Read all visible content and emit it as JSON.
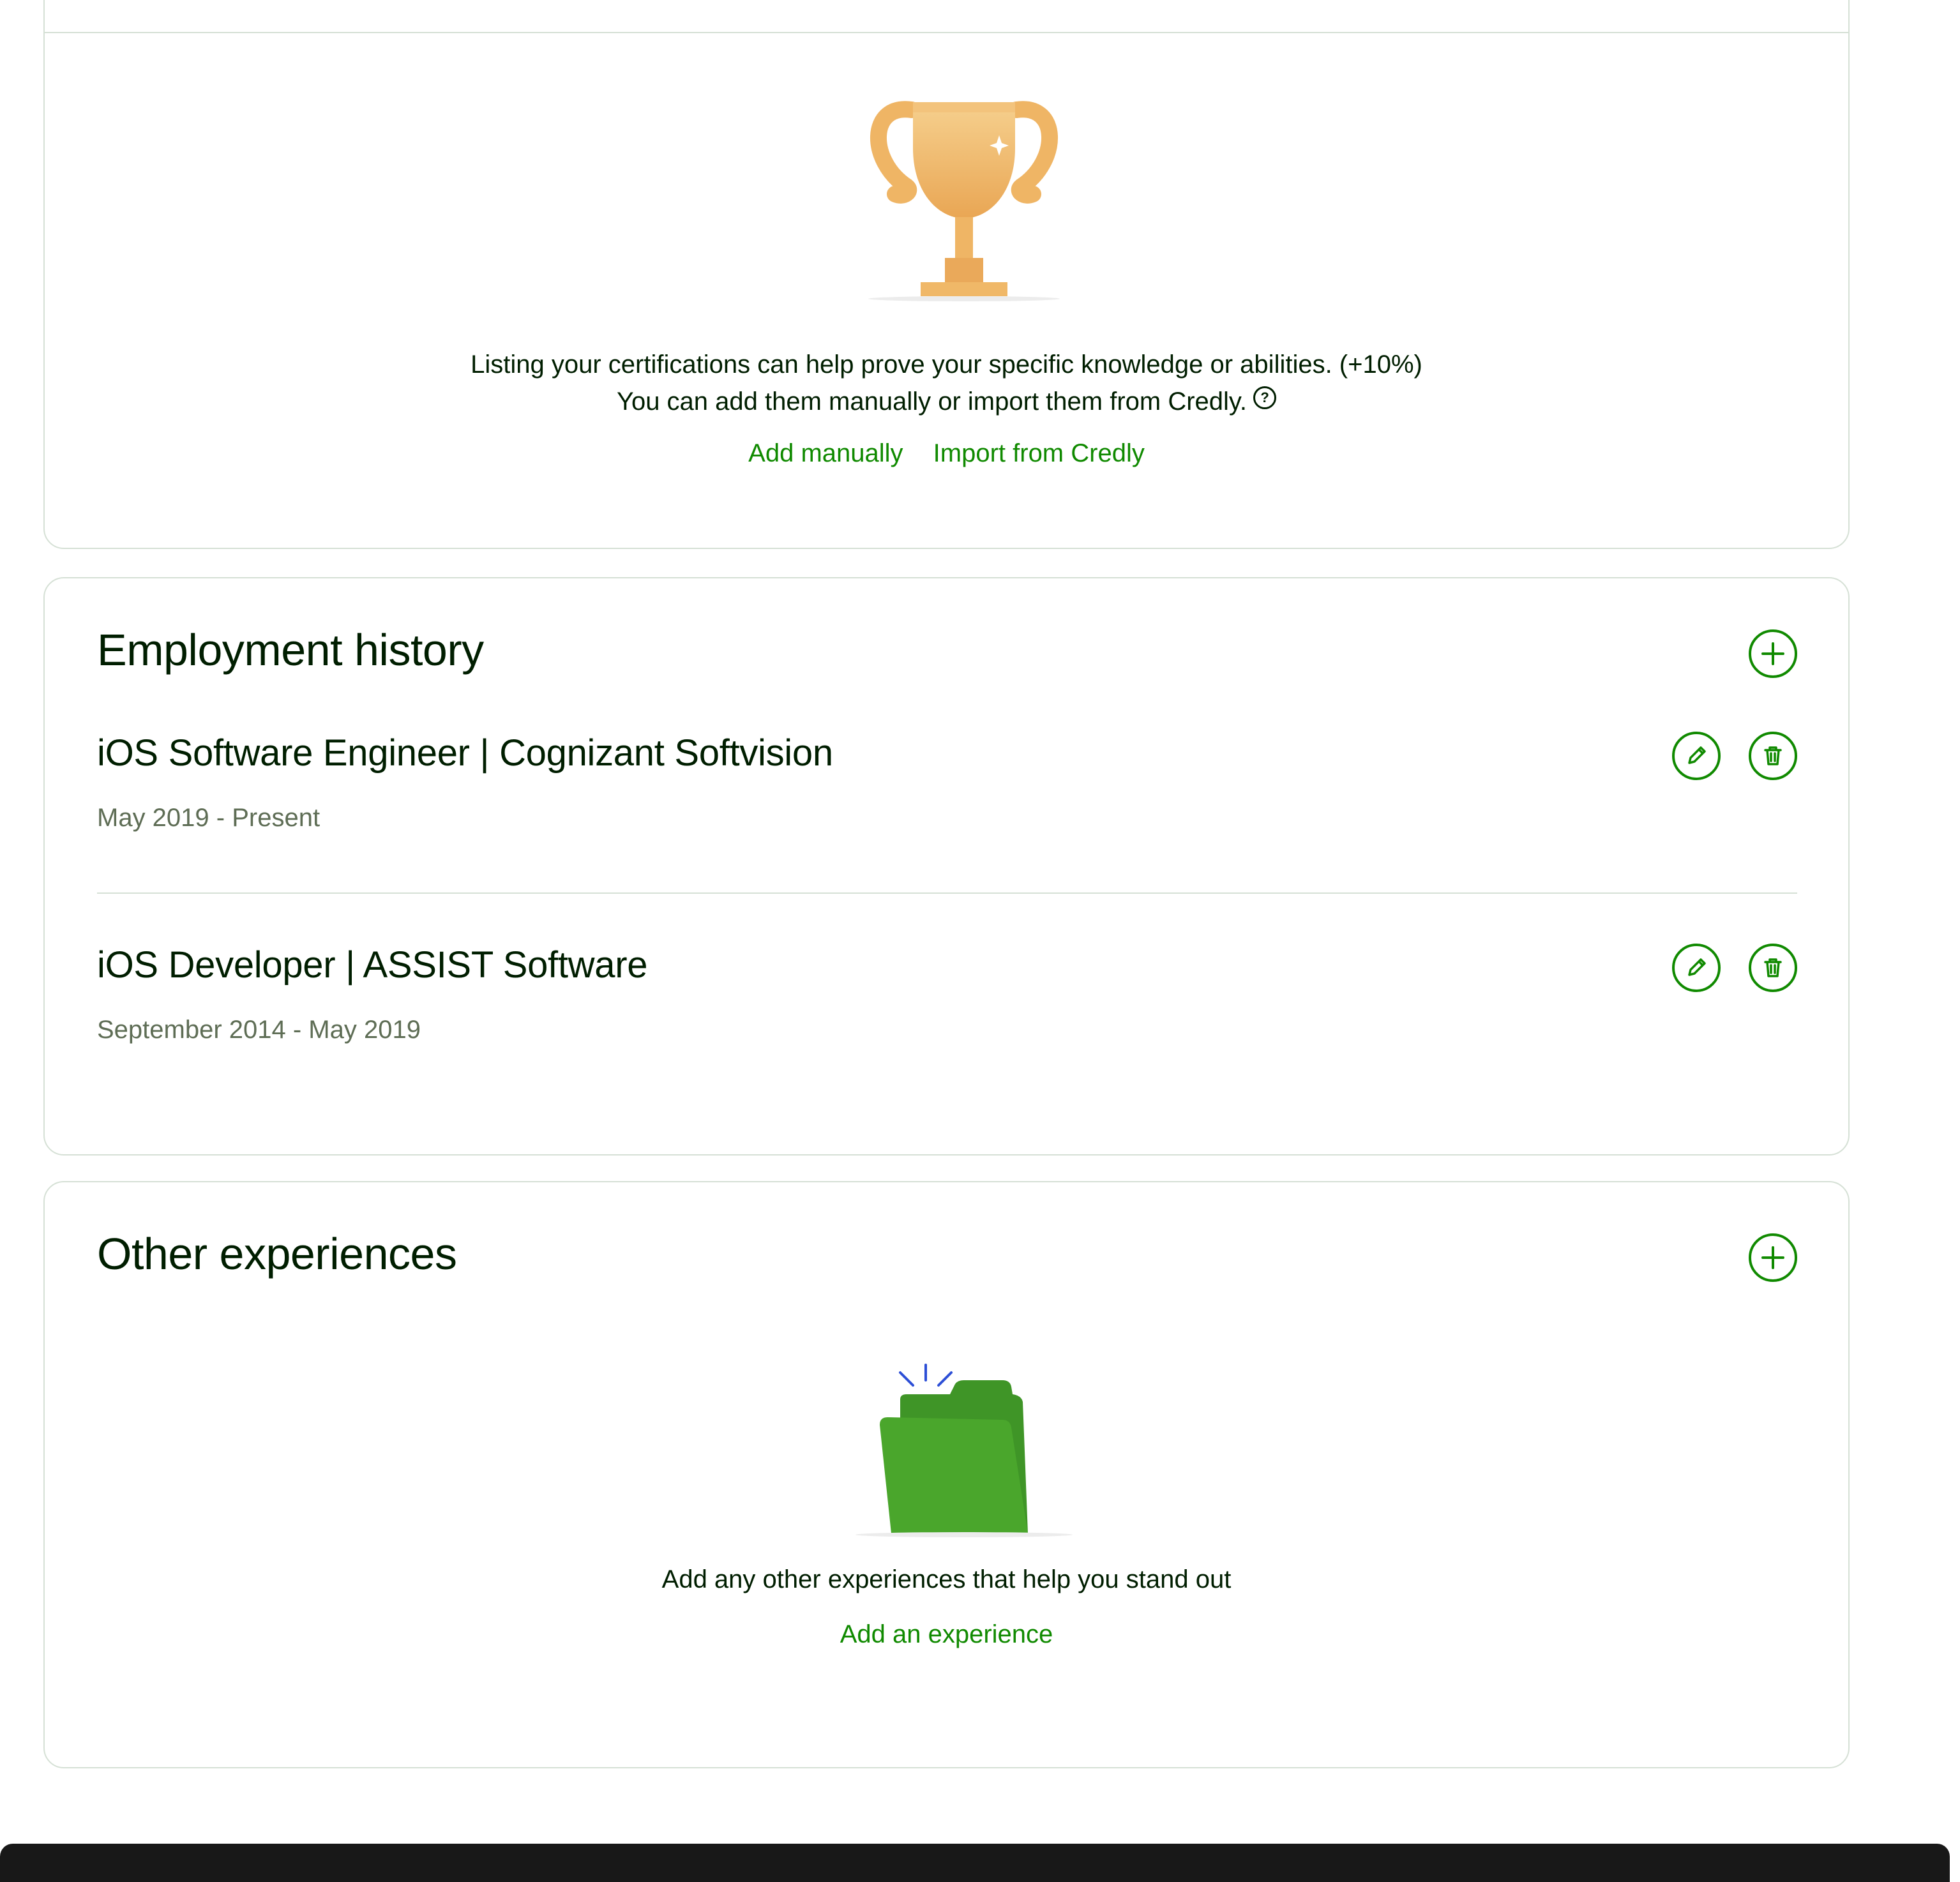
{
  "certifications": {
    "line1": "Listing your certifications can help prove your specific knowledge or abilities. (+10%)",
    "line2": "You can add them manually or import them from Credly.",
    "help_icon": "question-circle-icon",
    "add_manually_label": "Add manually",
    "import_label": "Import from Credly"
  },
  "employment": {
    "title": "Employment history",
    "jobs": [
      {
        "title": "iOS Software Engineer | Cognizant Softvision",
        "dates": "May 2019 - Present"
      },
      {
        "title": "iOS Developer | ASSIST Software",
        "dates": "September 2014 - May 2019"
      }
    ]
  },
  "other": {
    "title": "Other experiences",
    "description": "Add any other experiences that help you stand out",
    "add_label": "Add an experience"
  },
  "icons": {
    "add": "plus-circle-icon",
    "edit": "pencil-icon",
    "delete": "trash-icon",
    "trophy": "trophy-illustration",
    "folder": "folder-illustration"
  },
  "colors": {
    "accent": "#108a00",
    "text": "#001e00",
    "muted": "#5e6d55",
    "border": "#d5e0d5",
    "trophy": "#f2c17a",
    "folder": "#4aa62c"
  }
}
